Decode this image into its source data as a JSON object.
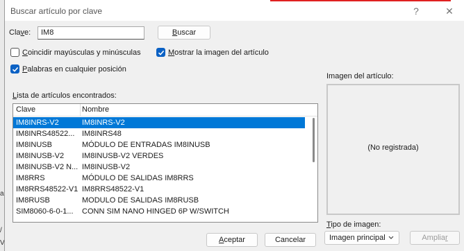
{
  "window": {
    "title": "Buscar artículo por clave",
    "help_glyph": "?",
    "close_glyph": "✕"
  },
  "search": {
    "label_pre": "Cla",
    "label_u": "v",
    "label_post": "e:",
    "value": "IM8",
    "button_u": "B",
    "button_rest": "uscar"
  },
  "options": {
    "match_case_u": "C",
    "match_case_rest": "oincidir mayúsculas y minúsculas",
    "match_case_checked": false,
    "show_image_u": "M",
    "show_image_rest": "ostrar la imagen del artículo",
    "show_image_checked": true,
    "any_position_u": "P",
    "any_position_rest": "alabras en cualquier posición",
    "any_position_checked": true
  },
  "results": {
    "label_u": "L",
    "label_rest": "ista de artículos encontrados:",
    "columns": [
      "Clave",
      "Nombre"
    ],
    "rows": [
      {
        "clave": "IM8INRS-V2",
        "nombre": "IM8INRS-V2",
        "selected": true
      },
      {
        "clave": "IM8INRS48522...",
        "nombre": "IM8INRS48",
        "selected": false
      },
      {
        "clave": "IM8INUSB",
        "nombre": "MÓDULO DE ENTRADAS IM8INUSB",
        "selected": false
      },
      {
        "clave": "IM8INUSB-V2",
        "nombre": "IM8INUSB-V2    VERDES",
        "selected": false
      },
      {
        "clave": "IM8INUSB-V2 N...",
        "nombre": "IM8INUSB-V2",
        "selected": false
      },
      {
        "clave": "IM8RRS",
        "nombre": "MÓDULO DE SALIDAS IM8RRS",
        "selected": false
      },
      {
        "clave": "IM8RRS48522-V1",
        "nombre": "IM8RRS48522-V1",
        "selected": false
      },
      {
        "clave": "IM8RUSB",
        "nombre": "MODULO DE SALIDAS IM8RUSB",
        "selected": false
      },
      {
        "clave": "SIM8060-6-0-1...",
        "nombre": "CONN SIM NANO HINGED 6P W/SWITCH",
        "selected": false
      }
    ]
  },
  "image_panel": {
    "label": "Imagen del artículo:",
    "placeholder": "(No registrada)",
    "type_label_u": "T",
    "type_label_rest": "ipo de imagen:",
    "type_value": "Imagen principal",
    "enlarge_pre": "Amplia",
    "enlarge_u": "r"
  },
  "footer": {
    "accept_u": "A",
    "accept_rest": "ceptar",
    "cancel": "Cancelar"
  },
  "background": {
    "edge_chars": [
      "a",
      "/",
      "V"
    ]
  },
  "colors": {
    "accent": "#0078d7",
    "checkbox": "#0b61c4",
    "title_line": "#e02020"
  }
}
